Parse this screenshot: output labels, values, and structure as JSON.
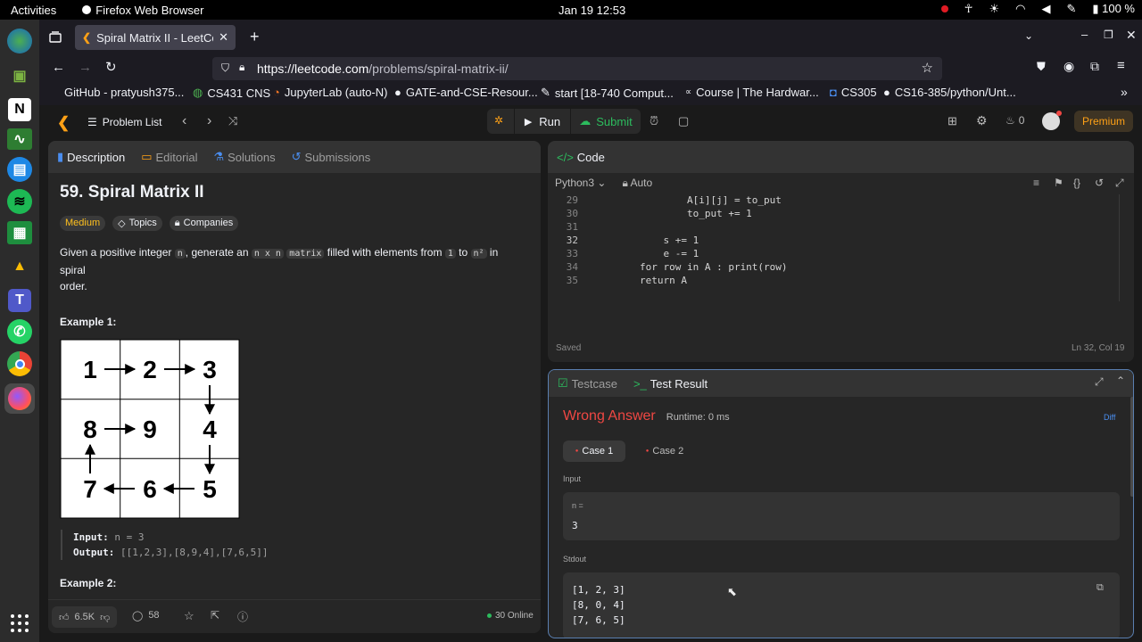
{
  "system": {
    "activities": "Activities",
    "app_name": "Firefox Web Browser",
    "clock": "Jan 19  12:53",
    "battery": "100 %"
  },
  "browser": {
    "tab_title": "Spiral Matrix II - LeetCode",
    "url_host": "https://leetcode.com",
    "url_path": "/problems/spiral-matrix-ii/",
    "bookmarks": [
      "GitHub - pratyush375...",
      "CS431 CNS",
      "JupyterLab (auto-N)",
      "GATE-and-CSE-Resour...",
      "start [18-740 Comput...",
      "Course | The Hardwar...",
      "CS305",
      "CS16-385/python/Unt..."
    ]
  },
  "leetcode": {
    "problem_list": "Problem List",
    "run": "Run",
    "submit": "Submit",
    "streak": "0",
    "premium": "Premium",
    "tabs": [
      "Description",
      "Editorial",
      "Solutions",
      "Submissions"
    ],
    "title": "59. Spiral Matrix II",
    "difficulty": "Medium",
    "topics": "Topics",
    "companies": "Companies",
    "desc_1": "Given a positive integer ",
    "desc_n": "n",
    "desc_2": ", generate an ",
    "desc_nxn": "n x n",
    "desc_matrix": "matrix",
    "desc_3": " filled with elements from ",
    "desc_one": "1",
    "desc_4": " to ",
    "desc_n2": "n²",
    "desc_5": " in spiral",
    "desc_6": "order.",
    "example1": "Example 1:",
    "matrix_cells": [
      "1",
      "2",
      "3",
      "8",
      "9",
      "4",
      "7",
      "6",
      "5"
    ],
    "ex_input_label": "Input:",
    "ex_input_value": "n = 3",
    "ex_output_label": "Output:",
    "ex_output_value": "[[1,2,3],[8,9,4],[7,6,5]]",
    "example2": "Example 2:",
    "likes": "6.5K",
    "comments": "58",
    "online": "30 Online"
  },
  "editor": {
    "header": "Code",
    "language": "Python3",
    "mode": "Auto",
    "lines": [
      {
        "n": "29",
        "code": "                A[i][j] = to_put"
      },
      {
        "n": "30",
        "code": "                to_put += 1"
      },
      {
        "n": "31",
        "code": ""
      },
      {
        "n": "32",
        "code": "            s += 1"
      },
      {
        "n": "33",
        "code": "            e -= 1"
      },
      {
        "n": "34",
        "code": "        for row in A : print(row)"
      },
      {
        "n": "35",
        "code": "        return A"
      }
    ],
    "saved": "Saved",
    "cursor": "Ln 32, Col 19"
  },
  "result": {
    "tab_testcase": "Testcase",
    "tab_result": "Test Result",
    "verdict": "Wrong Answer",
    "runtime": "Runtime: 0 ms",
    "diff": "Diff",
    "case1": "Case 1",
    "case2": "Case 2",
    "input_label": "Input",
    "var_label": "n =",
    "var_value": "3",
    "stdout_label": "Stdout",
    "stdout": [
      "[1, 2, 3]",
      "[8, 0, 4]",
      "[7, 6, 5]"
    ]
  },
  "colors": {
    "accent_green": "#2cbb5d",
    "wrong_red": "#ef4743",
    "medium_yellow": "#ffc01e",
    "premium_orange": "#ffa116"
  }
}
